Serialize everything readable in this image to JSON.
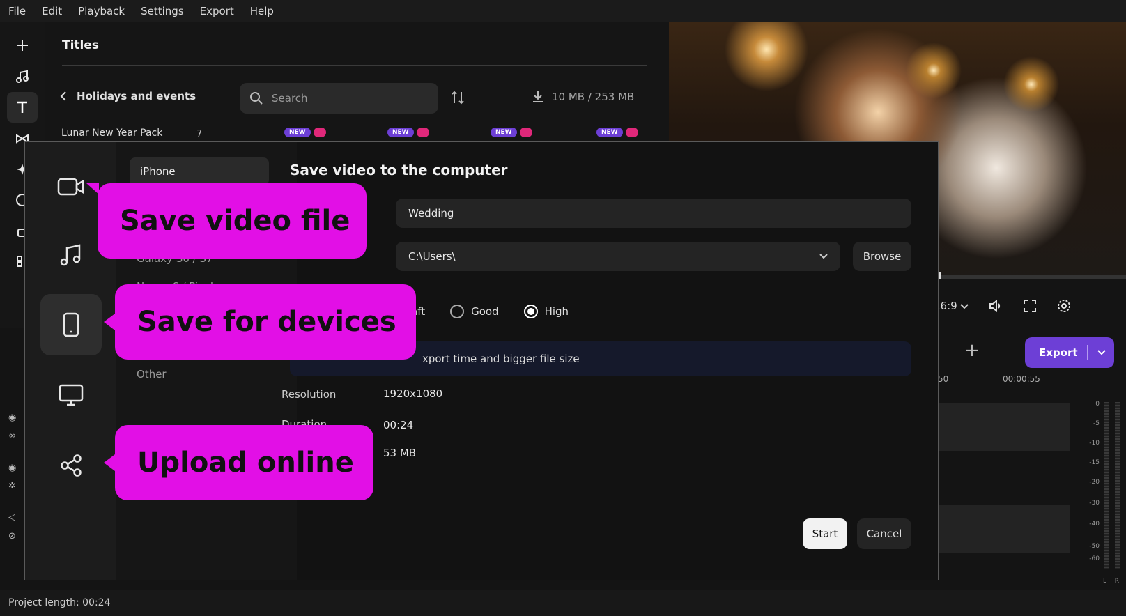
{
  "menu": [
    "File",
    "Edit",
    "Playback",
    "Settings",
    "Export",
    "Help"
  ],
  "left_toolbar": [
    "add-icon",
    "music-icon",
    "text-icon",
    "transition-icon",
    "effects-icon",
    "sticker-icon",
    "lock-icon",
    "grid-icon"
  ],
  "titles_panel": {
    "title": "Titles",
    "category": "Holidays and events",
    "search_placeholder": "Search",
    "storage": "10 MB / 253 MB",
    "pack_name": "Lunar New Year Pack",
    "pack_count": "7",
    "badge": "NEW"
  },
  "player": {
    "aspect": "16:9",
    "export_label": "Export"
  },
  "timeline": {
    "labels": [
      ":50",
      "00:00:55"
    ],
    "meter_levels": [
      "0",
      "-5",
      "-10",
      "-15",
      "-20",
      "-30",
      "-40",
      "-50",
      "-60"
    ],
    "meter_channels": [
      "L",
      "R"
    ]
  },
  "status": {
    "project_length": "Project length: 00:24"
  },
  "dialog": {
    "title": "Save video to the computer",
    "list": {
      "selected": "iPhone",
      "partial_1": "Galaxy S6 / S7",
      "partial_2": "Nexus 6 / Pixel",
      "other": "Other"
    },
    "file_name": "Wedding",
    "path": "C:\\Users\\",
    "browse": "Browse",
    "quality_partial": "aft",
    "quality_good": "Good",
    "quality_high": "High",
    "quality_selected": "High",
    "note_partial": "xport time and bigger file size",
    "resolution_label": "Resolution",
    "resolution_value": "1920x1080",
    "duration_label": "Duration",
    "duration_value": "00:24",
    "size_value": "53 MB",
    "start": "Start",
    "cancel": "Cancel"
  },
  "callouts": {
    "save_video": "Save video file",
    "save_devices": "Save for devices",
    "upload": "Upload online"
  },
  "colors": {
    "accent": "#6d3fd6",
    "callout": "#e20fe6",
    "new_badge": "#6d3fd6"
  }
}
